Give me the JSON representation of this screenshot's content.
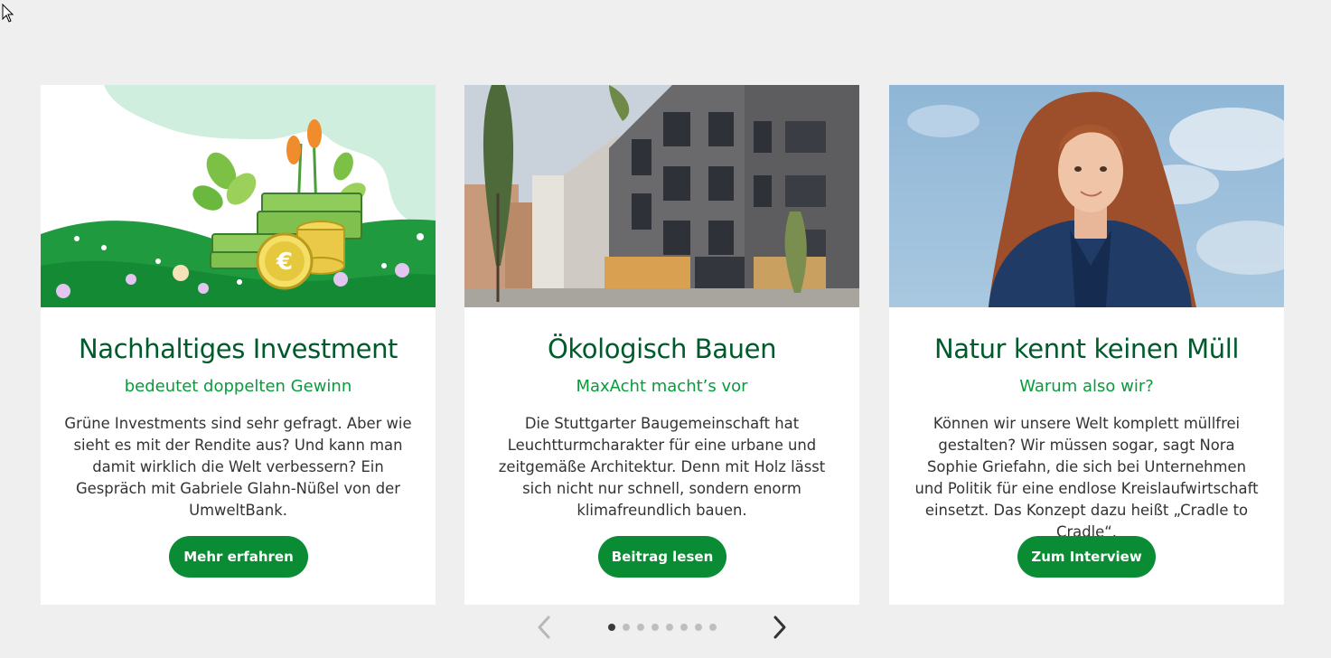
{
  "cards": [
    {
      "title": "Nachhaltiges Investment",
      "subtitle": "bedeutet doppelten Gewinn",
      "body": "Grüne Investments sind sehr gefragt. Aber wie sieht es mit der Rendite aus? Und kann man damit wirklich die Welt verbessern? Ein Gespräch mit Gabriele Glahn-Nüßel von der UmweltBank.",
      "button": "Mehr erfahren"
    },
    {
      "title": "Ökologisch Bauen",
      "subtitle": "MaxAcht macht’s vor",
      "body": "Die Stuttgarter Baugemeinschaft hat Leuchtturmcharakter für eine urbane und zeitgemäße Architektur. Denn mit Holz lässt sich nicht nur schnell, sondern enorm klimafreundlich bauen.",
      "button": "Beitrag lesen"
    },
    {
      "title": "Natur kennt keinen Müll",
      "subtitle": "Warum also wir?",
      "body": "Können wir unsere Welt komplett müllfrei gestalten? Wir müssen sogar, sagt Nora Sophie Griefahn, die sich bei Unternehmen und Politik für eine endlose Kreislaufwirtschaft einsetzt. Das Konzept dazu heißt „Cradle to Cradle“.",
      "button": "Zum Interview"
    }
  ],
  "carousel": {
    "total_pages": 8,
    "active_page": 1,
    "prev_icon": "chevron-left-icon",
    "next_icon": "chevron-right-icon"
  },
  "colors": {
    "title": "#005a2b",
    "subtitle": "#0a9a3c",
    "button": "#0a8c34",
    "background": "#efefef"
  }
}
